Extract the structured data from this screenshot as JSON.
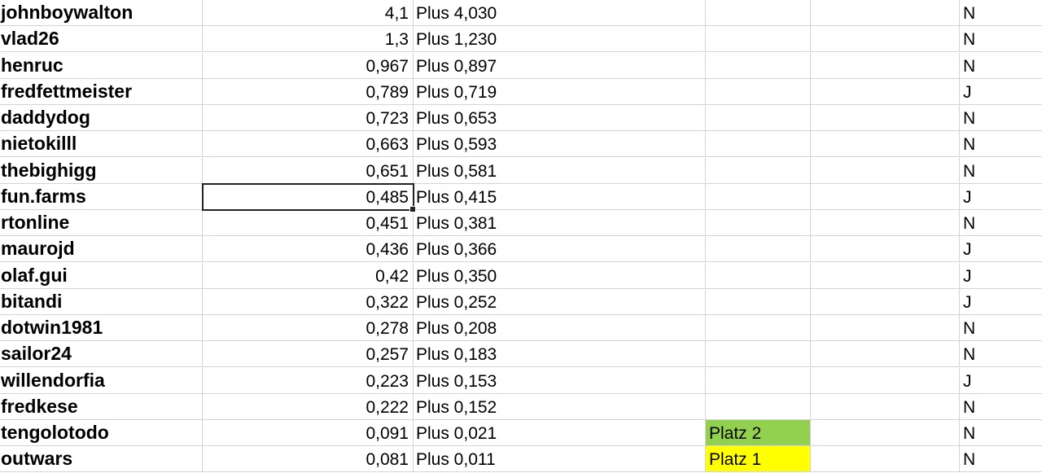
{
  "colors": {
    "platz1_fill": "#ffff00",
    "platz2_fill": "#92d050"
  },
  "rows": [
    {
      "name": "johnboywalton",
      "value": "4,1",
      "plus": "Plus 4,030",
      "platz": "",
      "flag": "N"
    },
    {
      "name": "vlad26",
      "value": "1,3",
      "plus": "Plus 1,230",
      "platz": "",
      "flag": "N"
    },
    {
      "name": "henruc",
      "value": "0,967",
      "plus": "Plus 0,897",
      "platz": "",
      "flag": "N"
    },
    {
      "name": "fredfettmeister",
      "value": "0,789",
      "plus": "Plus 0,719",
      "platz": "",
      "flag": "J"
    },
    {
      "name": "daddydog",
      "value": "0,723",
      "plus": "Plus 0,653",
      "platz": "",
      "flag": "N"
    },
    {
      "name": "nietokilll",
      "value": "0,663",
      "plus": "Plus 0,593",
      "platz": "",
      "flag": "N"
    },
    {
      "name": "thebighigg",
      "value": "0,651",
      "plus": "Plus 0,581",
      "platz": "",
      "flag": "N"
    },
    {
      "name": "fun.farms",
      "value": "0,485",
      "plus": "Plus 0,415",
      "platz": "",
      "flag": "J",
      "selected": true
    },
    {
      "name": "rtonline",
      "value": "0,451",
      "plus": "Plus 0,381",
      "platz": "",
      "flag": "N"
    },
    {
      "name": "maurojd",
      "value": "0,436",
      "plus": "Plus 0,366",
      "platz": "",
      "flag": "J"
    },
    {
      "name": "olaf.gui",
      "value": "0,42",
      "plus": "Plus 0,350",
      "platz": "",
      "flag": "J"
    },
    {
      "name": "bitandi",
      "value": "0,322",
      "plus": "Plus 0,252",
      "platz": "",
      "flag": "J"
    },
    {
      "name": "dotwin1981",
      "value": "0,278",
      "plus": "Plus 0,208",
      "platz": "",
      "flag": "N"
    },
    {
      "name": "sailor24",
      "value": "0,257",
      "plus": "Plus 0,183",
      "platz": "",
      "flag": "N"
    },
    {
      "name": "willendorfia",
      "value": "0,223",
      "plus": "Plus 0,153",
      "platz": "",
      "flag": "J"
    },
    {
      "name": "fredkese",
      "value": "0,222",
      "plus": "Plus 0,152",
      "platz": "",
      "flag": "N"
    },
    {
      "name": "tengolotodo",
      "value": "0,091",
      "plus": "Plus 0,021",
      "platz": "Platz 2",
      "platz_color": "platz2_fill",
      "flag": "N"
    },
    {
      "name": "outwars",
      "value": "0,081",
      "plus": "Plus 0,011",
      "platz": "Platz 1",
      "platz_color": "platz1_fill",
      "flag": "N"
    }
  ]
}
